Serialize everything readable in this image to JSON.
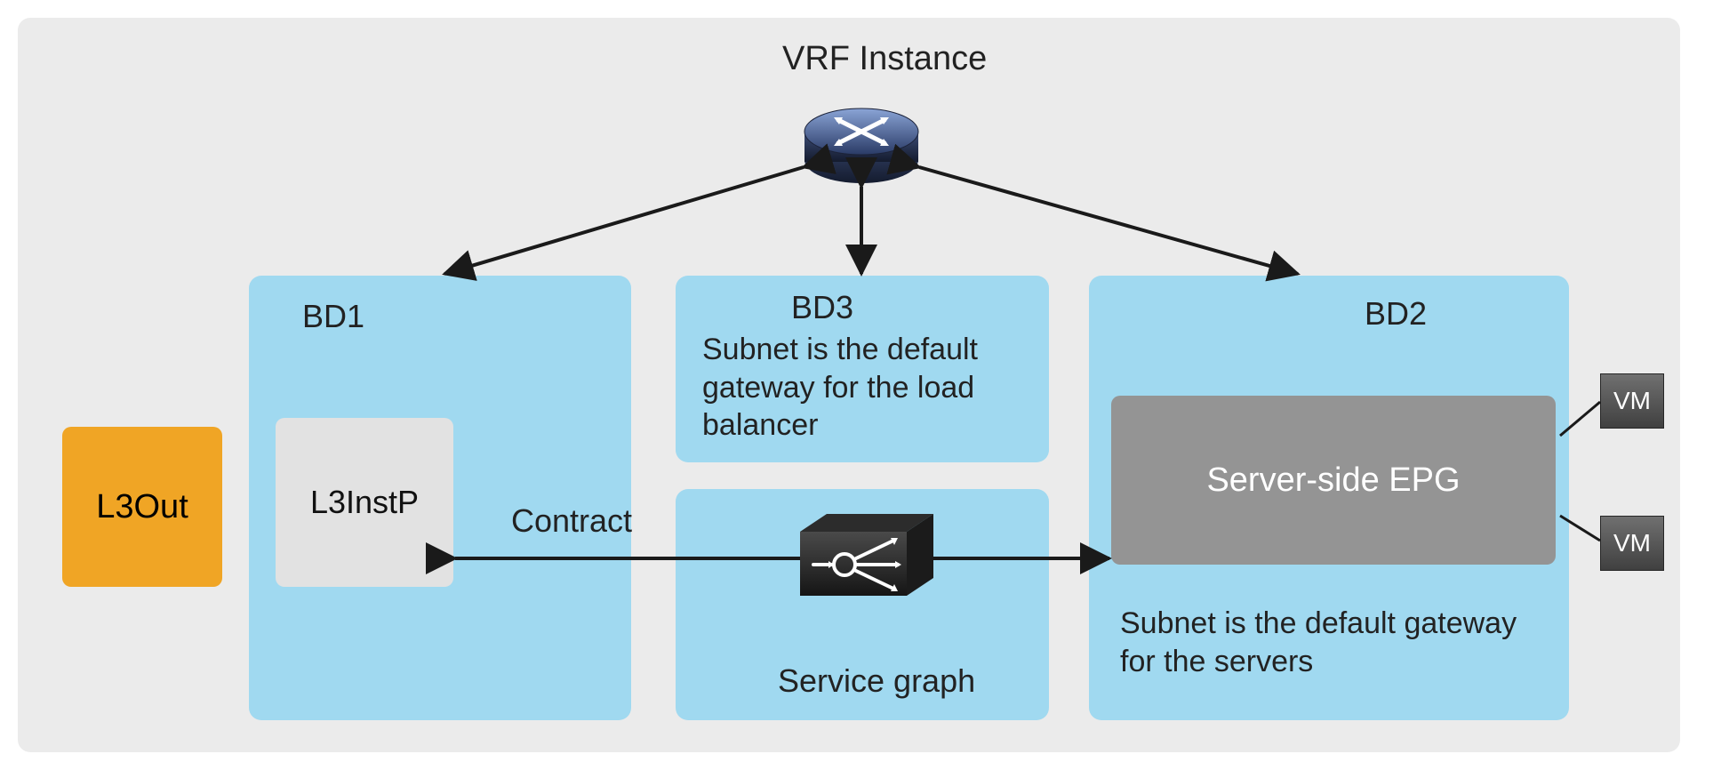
{
  "title": "VRF Instance",
  "l3out": "L3Out",
  "bd1": {
    "title": "BD1",
    "inner": "L3InstP"
  },
  "bd3": {
    "title": "BD3",
    "subtitle": "Subnet is the default gateway for the load balancer"
  },
  "bd2": {
    "title": "BD2",
    "epg": "Server-side EPG",
    "subtitle": "Subnet is the default gateway for the servers"
  },
  "contract_label": "Contract",
  "service_graph_label": "Service graph",
  "vm_label": "VM",
  "icons": {
    "router": "router-icon",
    "load_balancer": "load-balancer-icon",
    "vm": "vm-icon"
  }
}
